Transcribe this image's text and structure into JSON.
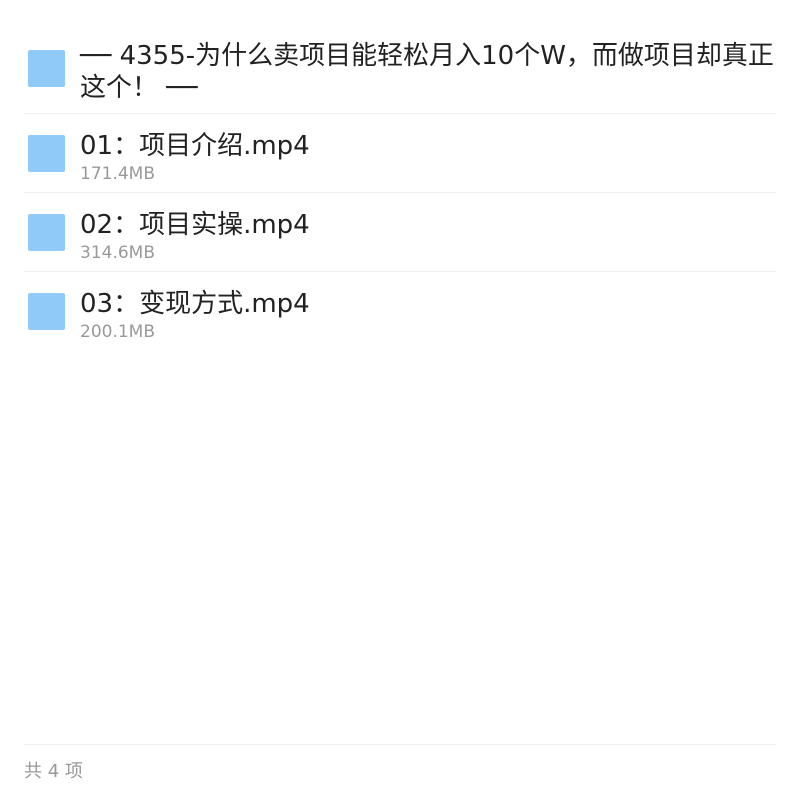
{
  "folder": {
    "icon": "folder-icon",
    "title_line1": "── 4355-为什么卖项目能轻松月入10个W，而做项目却真正",
    "title_line2": "这个！ ──"
  },
  "files": [
    {
      "icon": "file-icon",
      "name": "01：项目介绍.mp4",
      "size": "171.4MB"
    },
    {
      "icon": "file-icon",
      "name": "02：项目实操.mp4",
      "size": "314.6MB"
    },
    {
      "icon": "file-icon",
      "name": "03：变现方式.mp4",
      "size": "200.1MB"
    }
  ],
  "footer": {
    "count_label": "共 4 项"
  },
  "colors": {
    "icon": "#90caf9",
    "title": "#222222",
    "meta": "#999999",
    "divider": "#eeeeee"
  }
}
